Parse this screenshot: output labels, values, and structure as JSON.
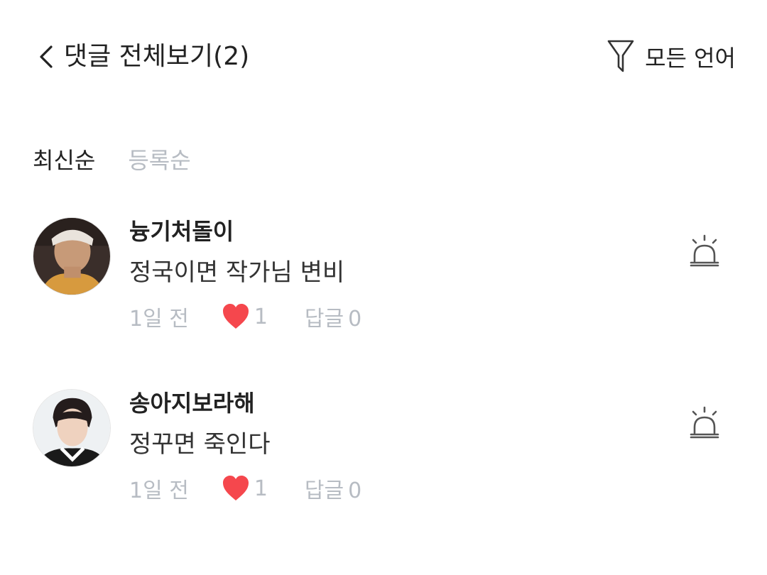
{
  "header": {
    "back_icon": "chevron-left-icon",
    "title": "댓글 전체보기(2)",
    "filter_icon": "funnel-icon",
    "filter_label": "모든 언어"
  },
  "sort": {
    "tabs": [
      {
        "label": "최신순",
        "active": true
      },
      {
        "label": "등록순",
        "active": false
      }
    ]
  },
  "comments": [
    {
      "nickname": "늉기처돌이",
      "text": "정국이면 작가님 변비",
      "time": "1일 전",
      "likes": "1",
      "reply_label": "답글",
      "reply_count": "0",
      "report_icon": "siren-icon"
    },
    {
      "nickname": "송아지보라해",
      "text": "정꾸면 죽인다",
      "time": "1일 전",
      "likes": "1",
      "reply_label": "답글",
      "reply_count": "0",
      "report_icon": "siren-icon"
    }
  ],
  "colors": {
    "text_primary": "#222222",
    "text_muted": "#b7bcc3",
    "heart": "#f5474d",
    "icon_stroke": "#555555"
  }
}
